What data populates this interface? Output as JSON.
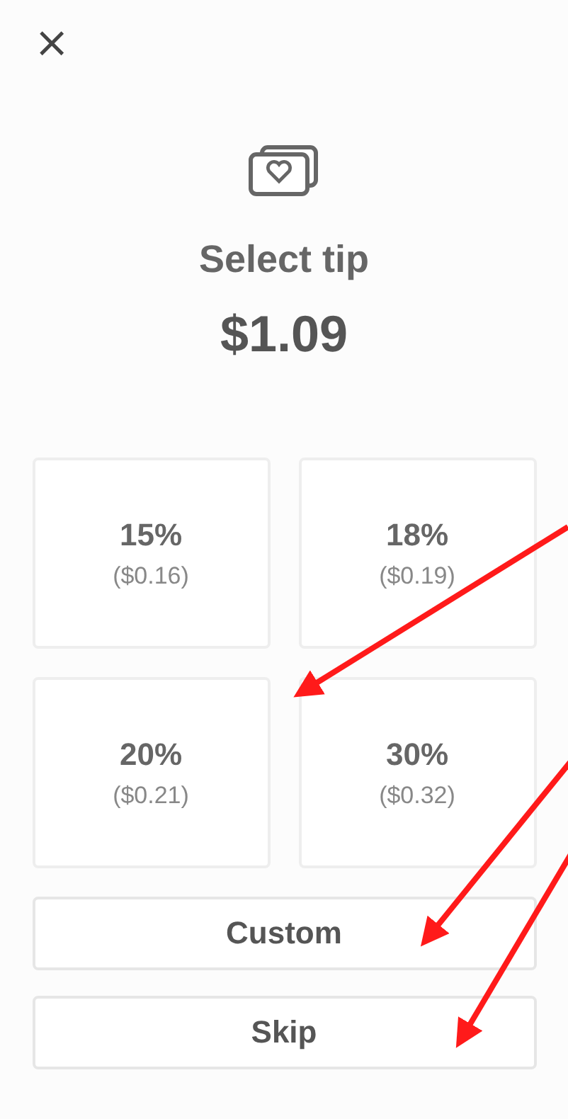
{
  "close": {
    "glyph": "×"
  },
  "title": "Select tip",
  "total": "$1.09",
  "options": [
    {
      "percent": "15%",
      "amount": "($0.16)"
    },
    {
      "percent": "18%",
      "amount": "($0.19)"
    },
    {
      "percent": "20%",
      "amount": "($0.21)"
    },
    {
      "percent": "30%",
      "amount": "($0.32)"
    }
  ],
  "buttons": [
    "Custom",
    "Skip"
  ]
}
